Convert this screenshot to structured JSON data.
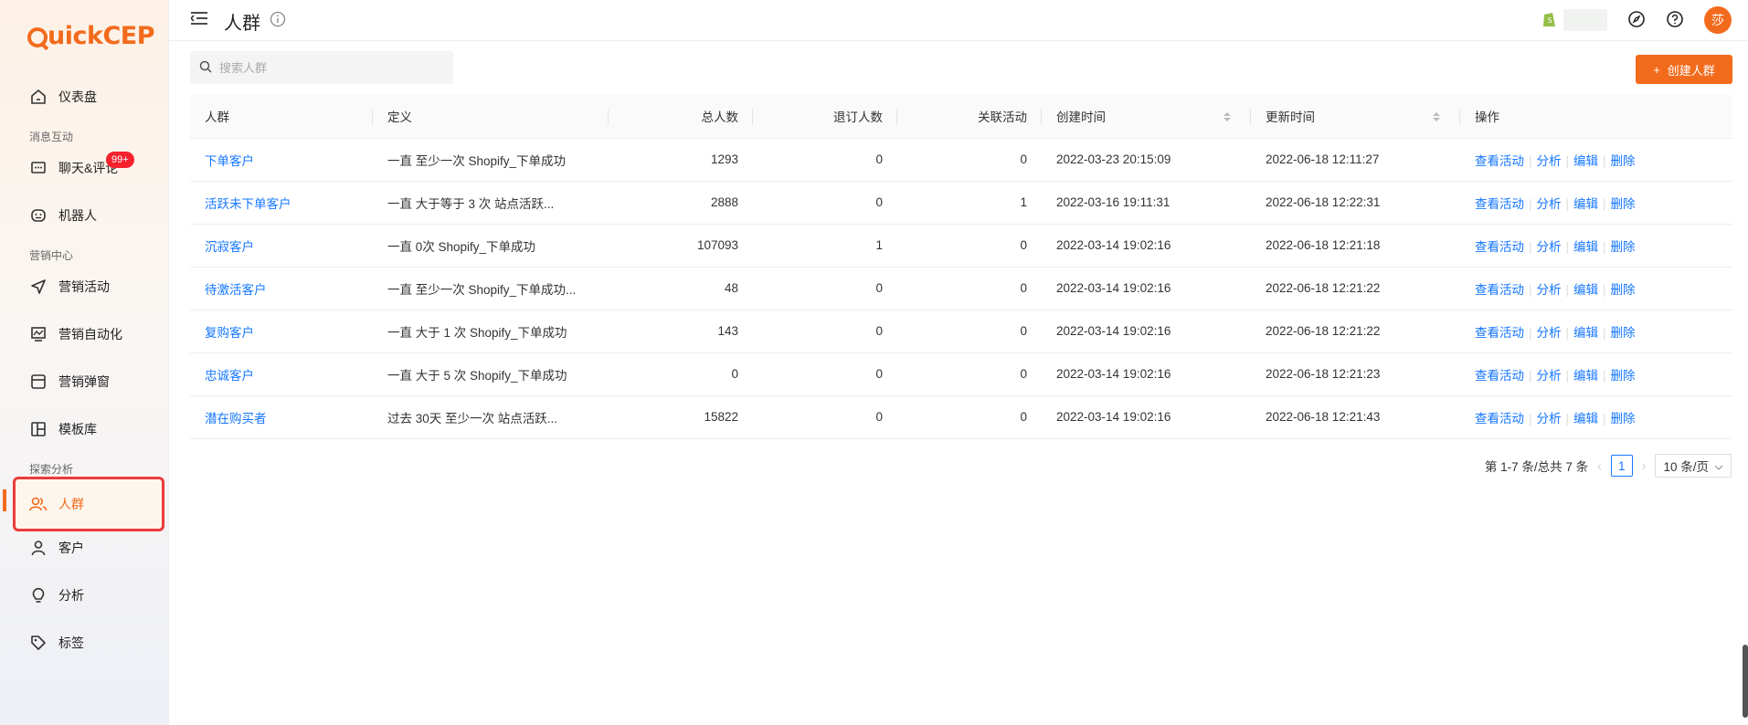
{
  "app": {
    "logo": "uickCEP",
    "brand_color": "#f26b1d"
  },
  "sidebar": {
    "items": [
      {
        "label": "仪表盘",
        "icon": "home-icon"
      },
      {
        "group": "消息互动"
      },
      {
        "label": "聊天&评论",
        "icon": "chat-icon",
        "badge": "99+"
      },
      {
        "label": "机器人",
        "icon": "robot-icon"
      },
      {
        "group": "营销中心"
      },
      {
        "label": "营销活动",
        "icon": "send-icon"
      },
      {
        "label": "营销自动化",
        "icon": "chart-icon"
      },
      {
        "label": "营销弹窗",
        "icon": "popup-icon"
      },
      {
        "label": "模板库",
        "icon": "template-icon"
      },
      {
        "group": "探索分析"
      },
      {
        "label": "人群",
        "icon": "users-icon",
        "active": true
      },
      {
        "label": "客户",
        "icon": "user-icon"
      },
      {
        "label": "分析",
        "icon": "bulb-icon"
      },
      {
        "label": "标签",
        "icon": "tag-icon"
      }
    ],
    "groups": {
      "msg": "消息互动",
      "marketing": "营销中心",
      "explore": "探索分析"
    },
    "labels": {
      "dashboard": "仪表盘",
      "chat": "聊天&评论",
      "chat_badge": "99+",
      "robot": "机器人",
      "campaign": "营销活动",
      "automation": "营销自动化",
      "popup": "营销弹窗",
      "templates": "模板库",
      "segments": "人群",
      "customers": "客户",
      "analysis": "分析",
      "tags": "标签"
    }
  },
  "header": {
    "title": "人群",
    "avatar_text": "莎"
  },
  "toolbar": {
    "search_placeholder": "搜索人群",
    "create_label": "创建人群",
    "create_plus": "+"
  },
  "table": {
    "columns": {
      "segment": "人群",
      "definition": "定义",
      "total": "总人数",
      "unsubscribed": "退订人数",
      "linked": "关联活动",
      "created": "创建时间",
      "updated": "更新时间",
      "actions": "操作"
    },
    "action_labels": {
      "view": "查看活动",
      "analyze": "分析",
      "edit": "编辑",
      "delete": "删除"
    },
    "rows": [
      {
        "name": "下单客户",
        "def": "一直 至少一次 Shopify_下单成功",
        "total": "1293",
        "unsub": "0",
        "linked": "0",
        "created": "2022-03-23 20:15:09",
        "updated": "2022-06-18 12:11:27"
      },
      {
        "name": "活跃未下单客户",
        "def": "一直 大于等于 3 次 站点活跃...",
        "total": "2888",
        "unsub": "0",
        "linked": "1",
        "created": "2022-03-16 19:11:31",
        "updated": "2022-06-18 12:22:31"
      },
      {
        "name": "沉寂客户",
        "def": "一直 0次 Shopify_下单成功",
        "total": "107093",
        "unsub": "1",
        "linked": "0",
        "created": "2022-03-14 19:02:16",
        "updated": "2022-06-18 12:21:18"
      },
      {
        "name": "待激活客户",
        "def": "一直 至少一次 Shopify_下单成功...",
        "total": "48",
        "unsub": "0",
        "linked": "0",
        "created": "2022-03-14 19:02:16",
        "updated": "2022-06-18 12:21:22"
      },
      {
        "name": "复购客户",
        "def": "一直 大于 1 次 Shopify_下单成功",
        "total": "143",
        "unsub": "0",
        "linked": "0",
        "created": "2022-03-14 19:02:16",
        "updated": "2022-06-18 12:21:22"
      },
      {
        "name": "忠诚客户",
        "def": "一直 大于 5 次 Shopify_下单成功",
        "total": "0",
        "unsub": "0",
        "linked": "0",
        "created": "2022-03-14 19:02:16",
        "updated": "2022-06-18 12:21:23"
      },
      {
        "name": "潜在购买者",
        "def": "过去 30天 至少一次 站点活跃...",
        "total": "15822",
        "unsub": "0",
        "linked": "0",
        "created": "2022-03-14 19:02:16",
        "updated": "2022-06-18 12:21:43"
      }
    ]
  },
  "pagination": {
    "summary": "第 1-7 条/总共 7 条",
    "current": "1",
    "page_size": "10 条/页"
  }
}
